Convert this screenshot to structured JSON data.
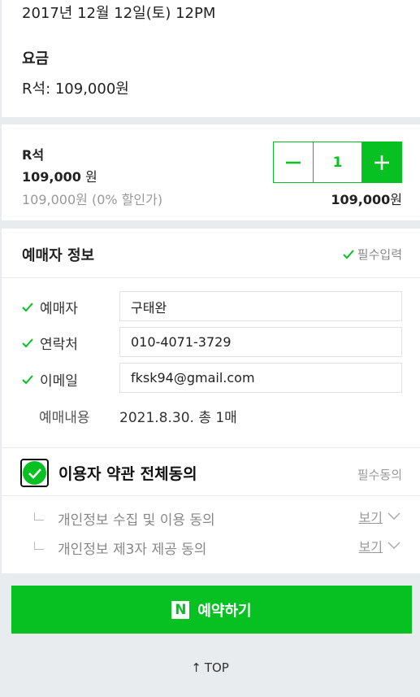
{
  "info": {
    "date": "2017년 12월 12일(토) 12PM",
    "fee_label": "요금",
    "fee_value": "R석: 109,000원"
  },
  "ticket": {
    "seat_name": "R석",
    "price_amount": "109,000",
    "price_unit": "원",
    "discount_text": "109,000원 (0% 할인가)",
    "quantity": "1",
    "total_amount": "109,000",
    "total_unit": "원"
  },
  "booker": {
    "title": "예매자 정보",
    "required_label": "필수입력",
    "rows": [
      {
        "label": "예매자",
        "value": "구태완"
      },
      {
        "label": "연락처",
        "value": "010-4071-3729"
      },
      {
        "label": "이메일",
        "value": "fksk94@gmail.com"
      }
    ],
    "order_label": "예매내용",
    "order_value": "2021.8.30. 총 1매"
  },
  "terms": {
    "agree_all_label": "이용자 약관 전체동의",
    "agree_all_checked": true,
    "required_label": "필수동의",
    "items": [
      {
        "label": "개인정보 수집 및 이용 동의",
        "link": "보기"
      },
      {
        "label": "개인정보 제3자 제공 동의",
        "link": "보기"
      }
    ]
  },
  "reserve_button": {
    "logo_letter": "N",
    "label": "예약하기"
  },
  "top_link": {
    "arrow": "↑",
    "label": "TOP"
  },
  "colors": {
    "accent": "#07c123",
    "background": "#e9ecef"
  }
}
